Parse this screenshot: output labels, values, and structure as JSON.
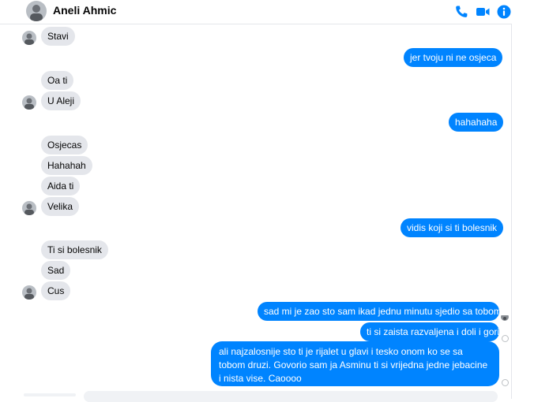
{
  "header": {
    "contact_name": "Aneli Ahmic",
    "accent_color": "#0084ff",
    "icons": [
      "phone-icon",
      "video-camera-icon",
      "info-icon"
    ]
  },
  "messages": [
    {
      "side": "in",
      "text": "Stavi"
    },
    {
      "side": "out",
      "text": "jer tvoju ni ne osjeca"
    },
    {
      "side": "in",
      "text": "Oa ti"
    },
    {
      "side": "in",
      "text": "U Aleji"
    },
    {
      "side": "out",
      "text": "hahahaha"
    },
    {
      "side": "in",
      "text": "Osjecas"
    },
    {
      "side": "in",
      "text": "Hahahah"
    },
    {
      "side": "in",
      "text": "Aida ti"
    },
    {
      "side": "in",
      "text": "Velika"
    },
    {
      "side": "out",
      "text": "vidis koji si ti bolesnik"
    },
    {
      "side": "in",
      "text": "Ti si bolesnik"
    },
    {
      "side": "in",
      "text": "Sad"
    },
    {
      "side": "in",
      "text": "Cus"
    },
    {
      "side": "out",
      "text": "sad mi je zao sto sam ikad jednu minutu sjedio sa tobom"
    },
    {
      "side": "out",
      "text": "ti si zaista razvaljena i doli i gori"
    },
    {
      "side": "out",
      "text": "ali najzalosnije sto ti je rijalet u glavi i tesko onom ko se sa tobom druzi. Govorio sam ja Asminu ti si vrijedna jedne jebacine i nista vise. Caoooo"
    }
  ],
  "colors": {
    "incoming_bubble": "#e4e6eb",
    "outgoing_bubble": "#0084ff"
  }
}
